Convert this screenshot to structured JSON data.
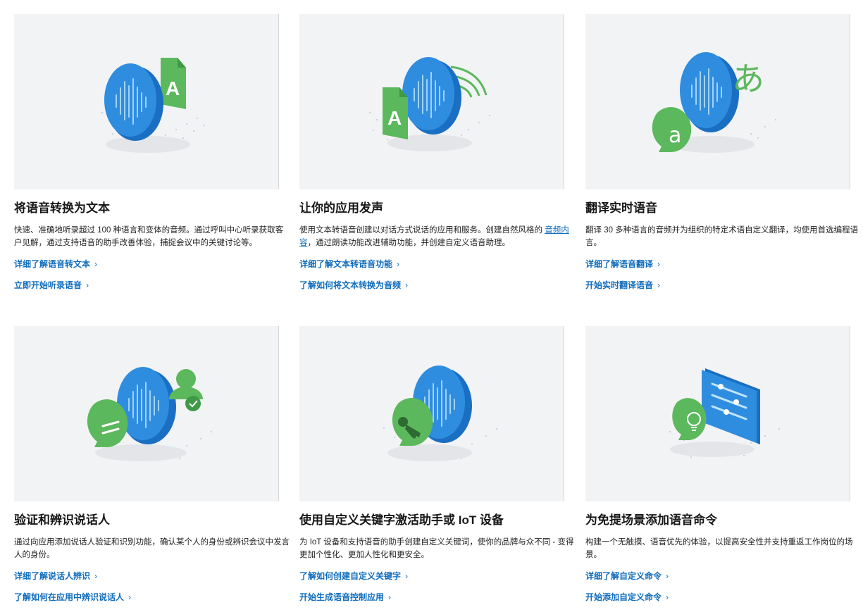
{
  "cards": [
    {
      "title": "将语音转换为文本",
      "desc": "快速、准确地听录超过 100 种语言和变体的音频。通过呼叫中心听录获取客户见解，通过支持语音的助手改善体验，捕捉会议中的关键讨论等。",
      "links": [
        "详细了解语音转文本",
        "立即开始听录语音"
      ],
      "icon": "speech-to-text-illustration"
    },
    {
      "title": "让你的应用发声",
      "desc_pre": "使用文本转语音创建以对话方式说话的应用和服务。创建自然风格的 ",
      "desc_link": "音频内容",
      "desc_post": "，通过朗读功能改进辅助功能，并创建自定义语音助理。",
      "links": [
        "详细了解文本转语音功能",
        "了解如何将文本转换为音频"
      ],
      "icon": "text-to-speech-illustration"
    },
    {
      "title": "翻译实时语音",
      "desc": "翻译 30 多种语言的音频并为组织的特定术语自定义翻译，均使用首选编程语言。",
      "links": [
        "详细了解语音翻译",
        "开始实时翻译语音"
      ],
      "icon": "speech-translation-illustration"
    },
    {
      "title": "验证和辨识说话人",
      "desc": "通过向应用添加说话人验证和识别功能，确认某个人的身份或辨识会议中发言人的身份。",
      "links": [
        "详细了解说话人辨识",
        "了解如何在应用中辨识说话人"
      ],
      "icon": "speaker-recognition-illustration"
    },
    {
      "title": "使用自定义关键字激活助手或 IoT 设备",
      "desc": "为 IoT 设备和支持语音的助手创建自定义关键词，使你的品牌与众不同 - 变得更加个性化、更加人性化和更安全。",
      "links": [
        "了解如何创建自定义关键字",
        "开始生成语音控制应用"
      ],
      "icon": "keyword-activation-illustration"
    },
    {
      "title": "为免提场景添加语音命令",
      "desc": "构建一个无触摸、语音优先的体验，以提高安全性并支持重返工作岗位的场景。",
      "links": [
        "详细了解自定义命令",
        "开始添加自定义命令"
      ],
      "icon": "voice-commands-illustration"
    }
  ],
  "chevron": "›",
  "colors": {
    "link": "#0f6cbd",
    "blue": "#1f7fd6",
    "green": "#5cb85c",
    "panel": "#f2f3f5"
  }
}
